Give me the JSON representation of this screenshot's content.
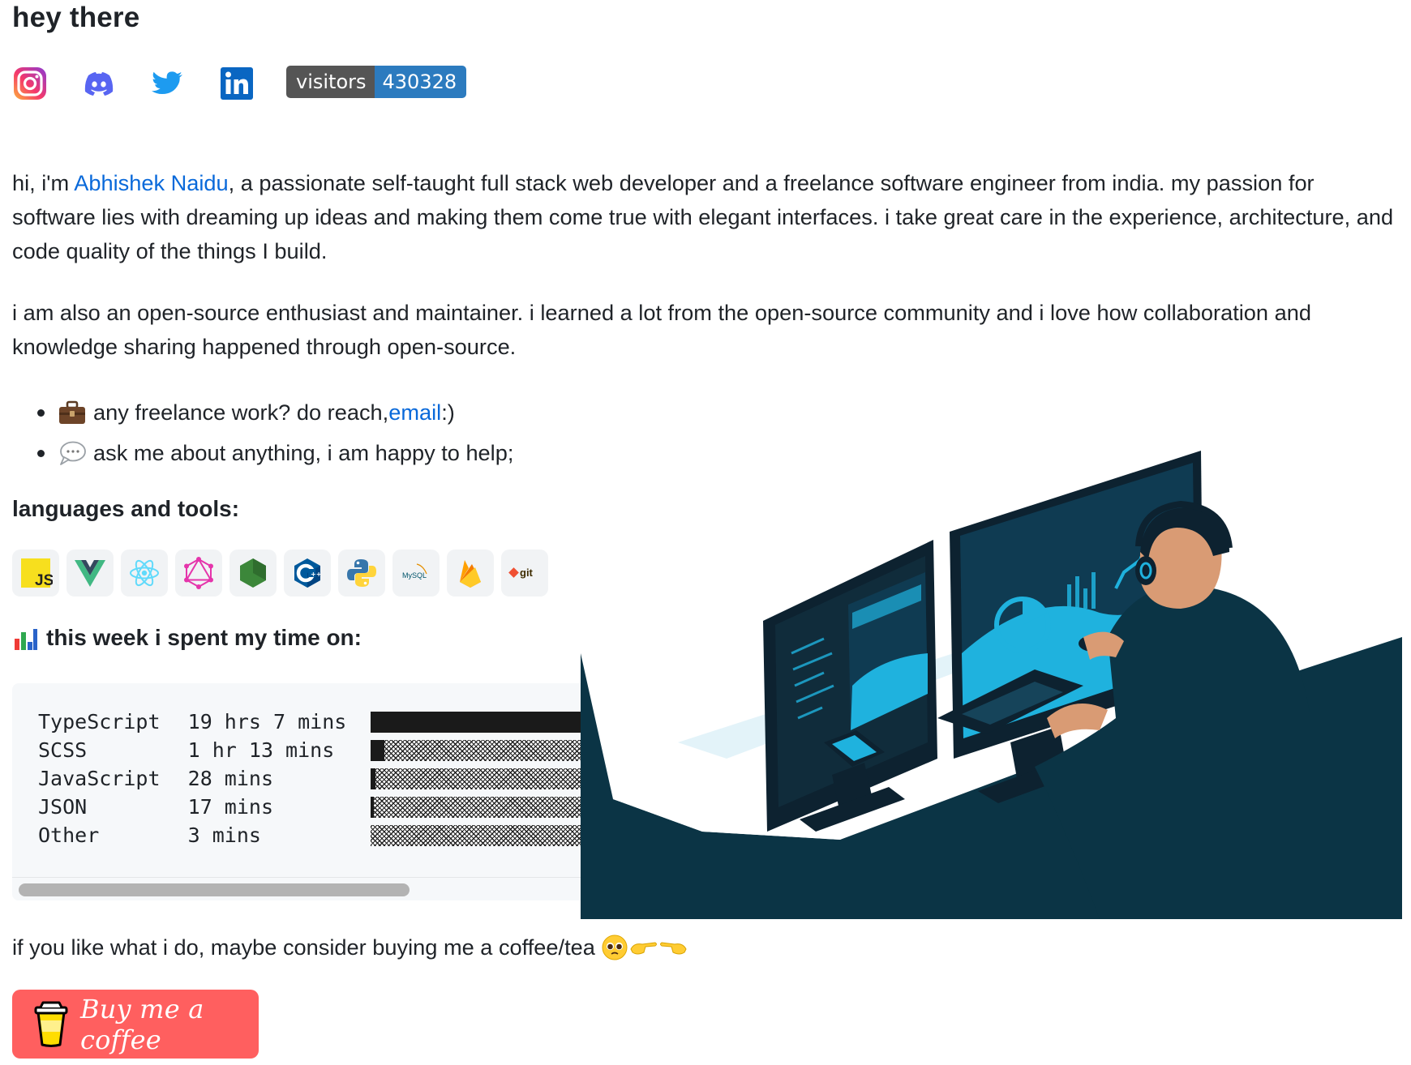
{
  "heading": "hey there",
  "socials": [
    {
      "name": "instagram",
      "icon": "instagram-icon"
    },
    {
      "name": "discord",
      "icon": "discord-icon"
    },
    {
      "name": "twitter",
      "icon": "twitter-icon"
    },
    {
      "name": "linkedin",
      "icon": "linkedin-icon"
    }
  ],
  "visitors_badge": {
    "label": "visitors",
    "count": "430328"
  },
  "intro": {
    "prefix": "hi, i'm ",
    "name_link": "Abhishek Naidu",
    "suffix": ", a passionate self-taught full stack web developer and a freelance software engineer from india. my passion for software lies with dreaming up ideas and making them come true with elegant interfaces. i take great care in the experience, architecture, and code quality of the things I build."
  },
  "open_source": "i am also an open-source enthusiast and maintainer. i learned a lot from the open-source community and i love how collaboration and knowledge sharing happened through open-source.",
  "bullets": [
    {
      "icon": "briefcase-icon",
      "text": "any freelance work? do reach, ",
      "link": "email",
      "after": " :)"
    },
    {
      "icon": "speech-bubble-icon",
      "text": "ask me about anything, i am happy to help;"
    }
  ],
  "languages_heading": "languages and tools:",
  "tools": [
    {
      "name": "javascript",
      "icon": "javascript-icon"
    },
    {
      "name": "vue",
      "icon": "vue-icon"
    },
    {
      "name": "react",
      "icon": "react-icon"
    },
    {
      "name": "graphql",
      "icon": "graphql-icon"
    },
    {
      "name": "nodejs",
      "icon": "nodejs-icon"
    },
    {
      "name": "cplusplus",
      "icon": "cplusplus-icon"
    },
    {
      "name": "python",
      "icon": "python-icon"
    },
    {
      "name": "mysql",
      "icon": "mysql-icon",
      "text": "MySQL"
    },
    {
      "name": "firebase",
      "icon": "firebase-icon"
    },
    {
      "name": "git",
      "icon": "git-icon",
      "text": "git"
    }
  ],
  "week_heading": "this week i spent my time on:",
  "week_stats": [
    {
      "language": "TypeScript",
      "time": "19 hrs 7 mins",
      "fraction": 1.0
    },
    {
      "language": "SCSS",
      "time": "1 hr 13 mins",
      "fraction": 0.064
    },
    {
      "language": "JavaScript",
      "time": "28 mins",
      "fraction": 0.024
    },
    {
      "language": "JSON",
      "time": "17 mins",
      "fraction": 0.015
    },
    {
      "language": "Other",
      "time": "3 mins",
      "fraction": 0.0
    }
  ],
  "coffee_line": "if you like what i do, maybe consider buying me a coffee/tea",
  "coffee_button": {
    "label": "Buy me a coffee",
    "color": "#ff5f5f"
  },
  "colors": {
    "link": "#0969da",
    "badge_key": "#555555",
    "badge_value": "#2c7bbf",
    "illustration_dark": "#0b3445",
    "illustration_accent": "#1fb2de"
  }
}
